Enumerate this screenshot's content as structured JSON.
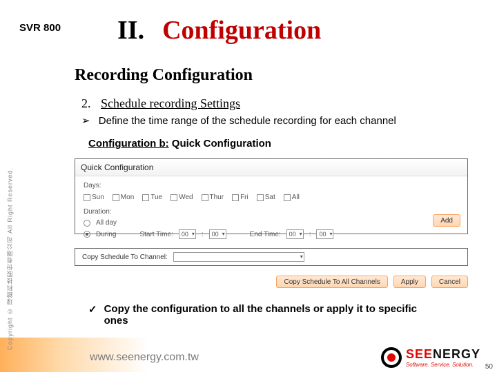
{
  "product": "SVR 800",
  "title": {
    "num": "II.",
    "text": "Configuration"
  },
  "section": "Recording Configuration",
  "item": {
    "num": "2.",
    "text": "Schedule recording Settings"
  },
  "arrow_bullet": "Define the time range of the schedule recording for each channel",
  "conf_b": {
    "pre": "Configuration b:",
    "post": " Quick Configuration"
  },
  "panel1": {
    "header": "Quick Configuration",
    "days_label": "Days:",
    "days": [
      "Sun",
      "Mon",
      "Tue",
      "Wed",
      "Thur",
      "Fri",
      "Sat",
      "All"
    ],
    "duration_label": "Duration:",
    "opt_allday": "All day",
    "opt_during": "During",
    "start_label": "Start Time:",
    "end_label": "End Time:",
    "hh": "00",
    "mm": "00",
    "add": "Add"
  },
  "panel2": {
    "label": "Copy Schedule To Channel:"
  },
  "buttons": {
    "copy": "Copy Schedule To All Channels",
    "apply": "Apply",
    "cancel": "Cancel"
  },
  "check_note": "Copy the configuration to all the channels or apply it to specific ones",
  "footer": {
    "copyright": "Copyright © 琭銨科技股份有限公司 All Right Reserved.",
    "url": "www.seenergy.com.tw",
    "logo_main": "SEENERGY",
    "logo_tag": "Software. Service. Solution.",
    "page": "50"
  }
}
